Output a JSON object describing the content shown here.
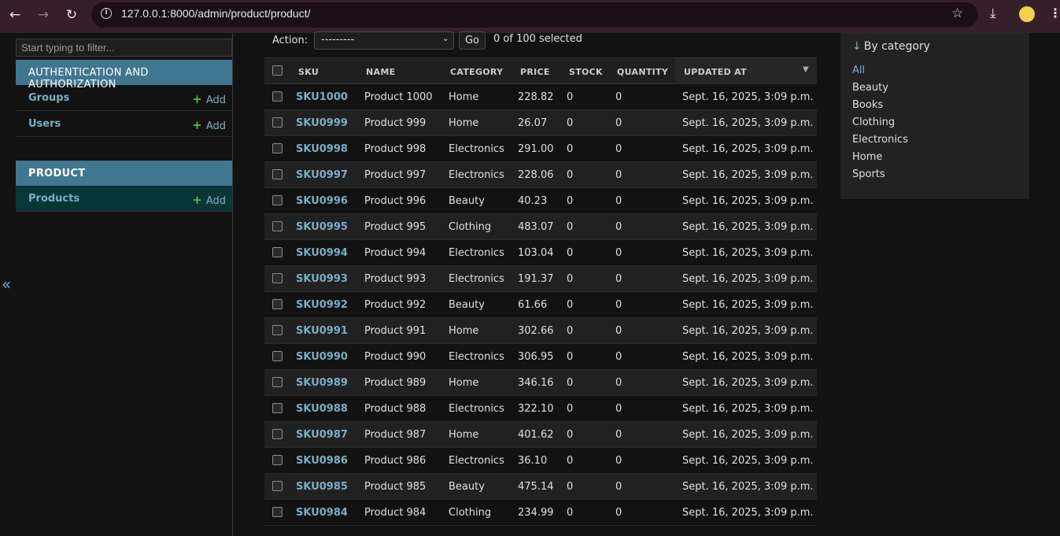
{
  "browser": {
    "url": "127.0.0.1:8000/admin/product/product/"
  },
  "nav": {
    "filter_placeholder": "Start typing to filter...",
    "modules": [
      {
        "caption": "AUTHENTICATION AND AUTHORIZATION",
        "models": [
          {
            "name": "Groups",
            "add": "Add"
          },
          {
            "name": "Users",
            "add": "Add"
          }
        ]
      },
      {
        "caption": "PRODUCT",
        "models": [
          {
            "name": "Products",
            "add": "Add"
          }
        ]
      }
    ],
    "collapse_glyph": "«"
  },
  "actions": {
    "label": "Action:",
    "selected_option": "---------",
    "go_label": "Go",
    "selected_count": "0 of 100 selected"
  },
  "table": {
    "headers": [
      "SKU",
      "NAME",
      "CATEGORY",
      "PRICE",
      "STOCK",
      "QUANTITY",
      "UPDATED AT"
    ],
    "rows": [
      [
        "SKU1000",
        "Product 1000",
        "Home",
        "228.82",
        "0",
        "0",
        "Sept. 16, 2025, 3:09 p.m."
      ],
      [
        "SKU0999",
        "Product 999",
        "Home",
        "26.07",
        "0",
        "0",
        "Sept. 16, 2025, 3:09 p.m."
      ],
      [
        "SKU0998",
        "Product 998",
        "Electronics",
        "291.00",
        "0",
        "0",
        "Sept. 16, 2025, 3:09 p.m."
      ],
      [
        "SKU0997",
        "Product 997",
        "Electronics",
        "228.06",
        "0",
        "0",
        "Sept. 16, 2025, 3:09 p.m."
      ],
      [
        "SKU0996",
        "Product 996",
        "Beauty",
        "40.23",
        "0",
        "0",
        "Sept. 16, 2025, 3:09 p.m."
      ],
      [
        "SKU0995",
        "Product 995",
        "Clothing",
        "483.07",
        "0",
        "0",
        "Sept. 16, 2025, 3:09 p.m."
      ],
      [
        "SKU0994",
        "Product 994",
        "Electronics",
        "103.04",
        "0",
        "0",
        "Sept. 16, 2025, 3:09 p.m."
      ],
      [
        "SKU0993",
        "Product 993",
        "Electronics",
        "191.37",
        "0",
        "0",
        "Sept. 16, 2025, 3:09 p.m."
      ],
      [
        "SKU0992",
        "Product 992",
        "Beauty",
        "61.66",
        "0",
        "0",
        "Sept. 16, 2025, 3:09 p.m."
      ],
      [
        "SKU0991",
        "Product 991",
        "Home",
        "302.66",
        "0",
        "0",
        "Sept. 16, 2025, 3:09 p.m."
      ],
      [
        "SKU0990",
        "Product 990",
        "Electronics",
        "306.95",
        "0",
        "0",
        "Sept. 16, 2025, 3:09 p.m."
      ],
      [
        "SKU0989",
        "Product 989",
        "Home",
        "346.16",
        "0",
        "0",
        "Sept. 16, 2025, 3:09 p.m."
      ],
      [
        "SKU0988",
        "Product 988",
        "Electronics",
        "322.10",
        "0",
        "0",
        "Sept. 16, 2025, 3:09 p.m."
      ],
      [
        "SKU0987",
        "Product 987",
        "Home",
        "401.62",
        "0",
        "0",
        "Sept. 16, 2025, 3:09 p.m."
      ],
      [
        "SKU0986",
        "Product 986",
        "Electronics",
        "36.10",
        "0",
        "0",
        "Sept. 16, 2025, 3:09 p.m."
      ],
      [
        "SKU0985",
        "Product 985",
        "Beauty",
        "475.14",
        "0",
        "0",
        "Sept. 16, 2025, 3:09 p.m."
      ],
      [
        "SKU0984",
        "Product 984",
        "Clothing",
        "234.99",
        "0",
        "0",
        "Sept. 16, 2025, 3:09 p.m."
      ]
    ]
  },
  "filter": {
    "heading": "By category",
    "heading_arrow": "↓",
    "options": [
      "All",
      "Beauty",
      "Books",
      "Clothing",
      "Electronics",
      "Home",
      "Sports"
    ],
    "selected": "All"
  },
  "colors": {
    "link": "#79aec8",
    "module_header": "#417690",
    "current_model_bg": "#0b3637",
    "add_plus": "#5bb75b",
    "browser_frame": "#35202a"
  }
}
